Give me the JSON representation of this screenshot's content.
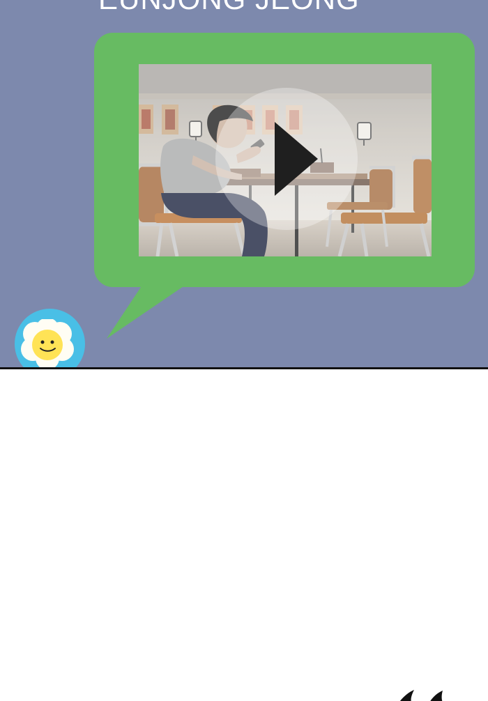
{
  "author": {
    "name": "EUNJONG JEONG"
  },
  "colors": {
    "panel_background": "#7d89ad",
    "speech_bubble": "#67bb62",
    "avatar_background": "#49bfe6",
    "page_background": "#ffffff",
    "play_icon": "#1f1f1f"
  },
  "icons": {
    "play": "play-icon",
    "avatar": "flower-smiley-avatar-icon"
  }
}
